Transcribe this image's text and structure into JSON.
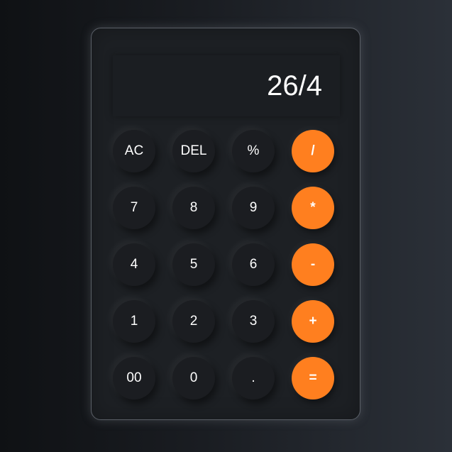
{
  "display": {
    "value": "26/4"
  },
  "keys": {
    "clear": "AC",
    "delete": "DEL",
    "percent": "%",
    "divide": "/",
    "seven": "7",
    "eight": "8",
    "nine": "9",
    "multiply": "*",
    "four": "4",
    "five": "5",
    "six": "6",
    "subtract": "-",
    "one": "1",
    "two": "2",
    "three": "3",
    "add": "+",
    "double_zero": "00",
    "zero": "0",
    "decimal": ".",
    "equals": "="
  },
  "colors": {
    "accent": "#ff7f1f",
    "key_background": "#1b1d21",
    "panel_background": "#1d2024"
  }
}
